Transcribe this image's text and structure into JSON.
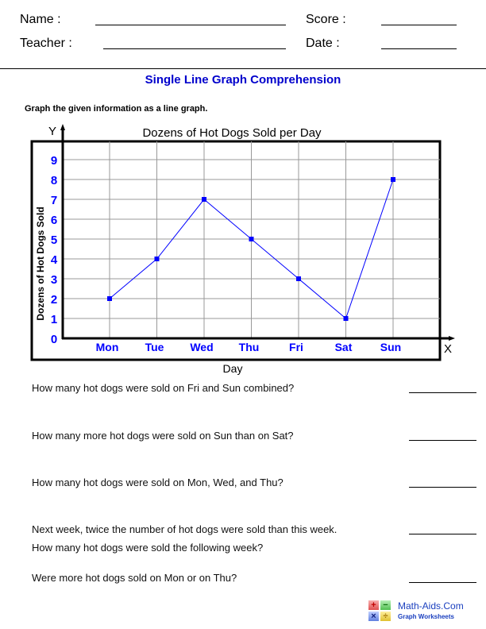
{
  "header": {
    "name_label": "Name :",
    "teacher_label": "Teacher :",
    "score_label": "Score :",
    "date_label": "Date :"
  },
  "worksheet": {
    "title": "Single Line Graph Comprehension",
    "instruction": "Graph the given information as a line graph."
  },
  "chart_data": {
    "type": "line",
    "title": "Dozens of Hot Dogs Sold per Day",
    "xlabel": "Day",
    "ylabel": "Dozens of Hot Dogs Sold",
    "x_axis_letter": "X",
    "y_axis_letter": "Y",
    "categories": [
      "Mon",
      "Tue",
      "Wed",
      "Thu",
      "Fri",
      "Sat",
      "Sun"
    ],
    "values": [
      2,
      4,
      7,
      5,
      3,
      1,
      8
    ],
    "yticks": [
      "0",
      "1",
      "2",
      "3",
      "4",
      "5",
      "6",
      "7",
      "8",
      "9"
    ],
    "ylim": [
      0,
      9
    ],
    "grid": true,
    "legend": "none",
    "line_color": "#0000ff",
    "tick_label_color": "#0000ff",
    "grid_color": "#999999"
  },
  "questions": [
    {
      "lines": [
        "How many hot dogs were sold on Fri and Sun combined?"
      ]
    },
    {
      "lines": [
        "How many more hot dogs were sold on Sun than on Sat?"
      ]
    },
    {
      "lines": [
        "How many hot dogs were sold on Mon, Wed, and Thu?"
      ]
    },
    {
      "lines": [
        "Next week, twice the number of hot dogs were sold than this week.",
        "How many hot dogs were sold the following week?"
      ]
    },
    {
      "lines": [
        "Were more hot dogs sold on Mon or on Thu?"
      ]
    }
  ],
  "logo": {
    "site": "Math-Aids.Com",
    "subtitle": "Graph Worksheets",
    "symbols": [
      "+",
      "−",
      "×",
      "÷"
    ]
  }
}
